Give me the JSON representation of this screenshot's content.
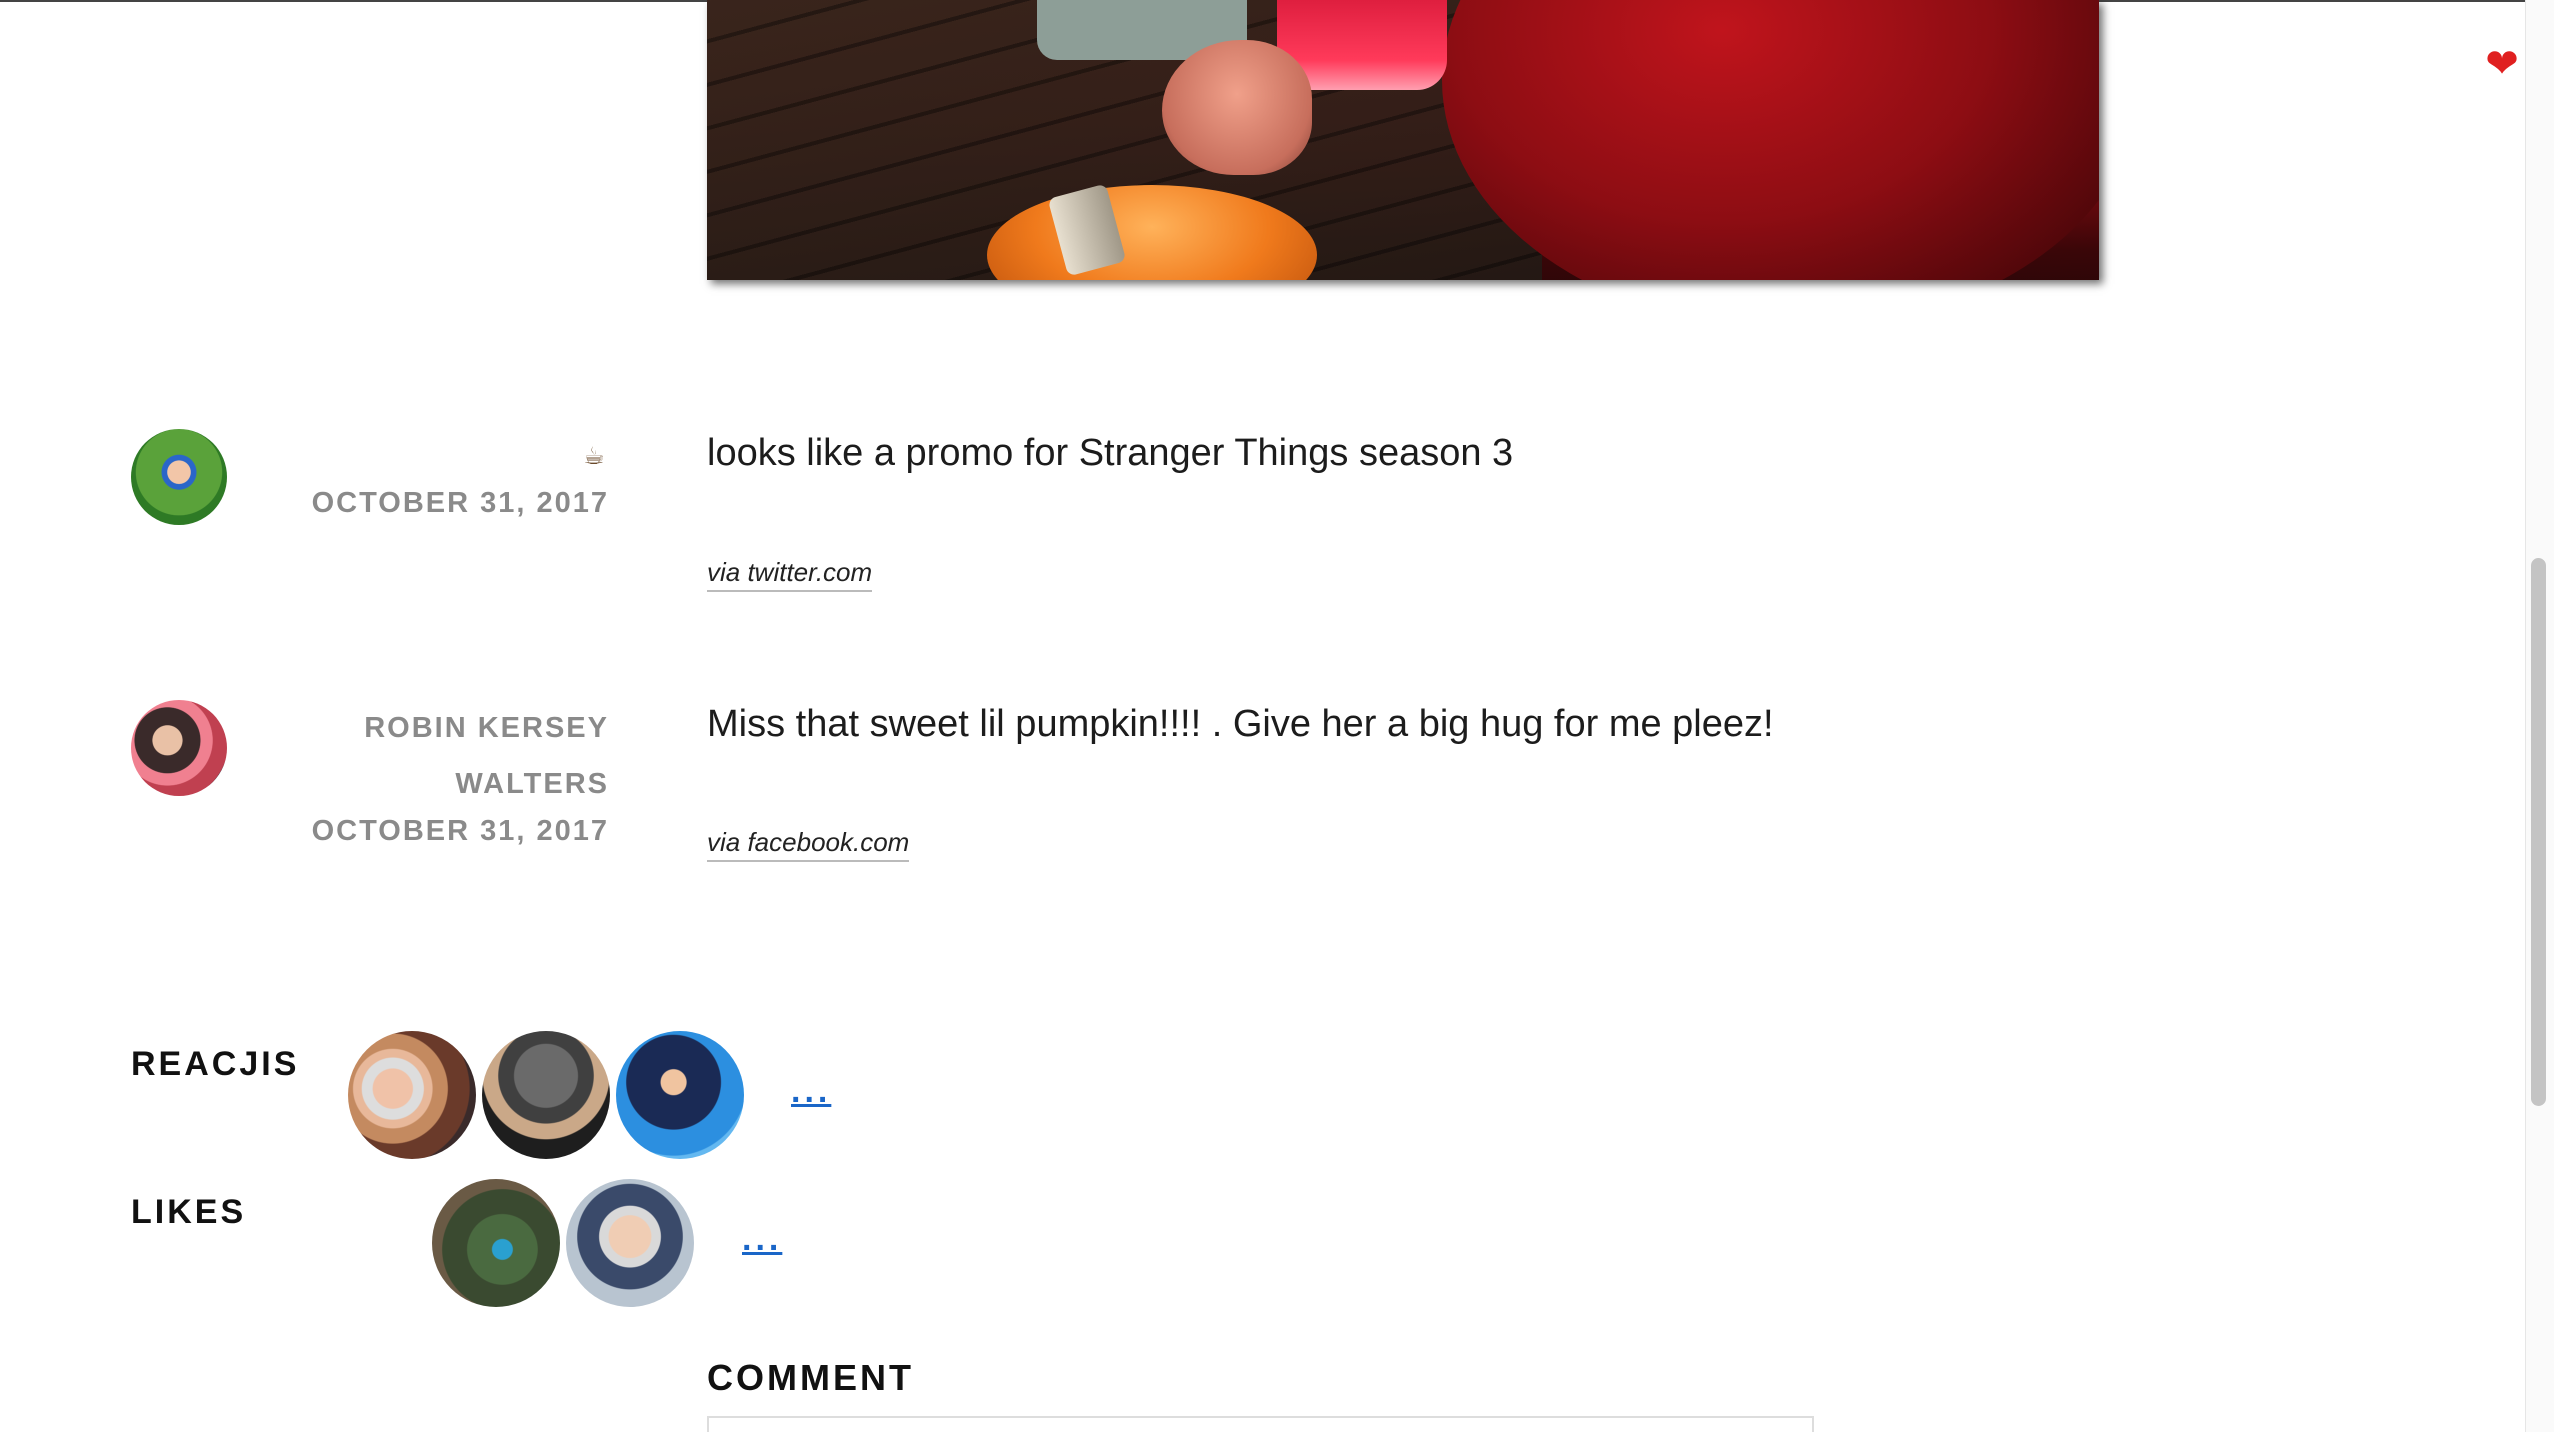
{
  "icons": {
    "heart": "heart-icon",
    "coffee": "coffee-icon"
  },
  "colors": {
    "link": "#1a66c8",
    "meta": "#8a8a8a",
    "heart": "#e02020"
  },
  "glyphs": {
    "heart": "❤",
    "coffee": "☕"
  },
  "comments": [
    {
      "author": "",
      "date": "OCTOBER 31, 2017",
      "text": "looks like a promo for Stranger Things season 3",
      "via": "via twitter.com"
    },
    {
      "author": "ROBIN KERSEY WALTERS",
      "date": "OCTOBER 31, 2017",
      "text": "Miss that sweet lil pumpkin!!!! . Give her a big hug for me pleez!",
      "via": "via facebook.com"
    }
  ],
  "reactions": {
    "reacjis_label": "REACJIS",
    "likes_label": "LIKES",
    "more_label": "..."
  },
  "comment_form": {
    "heading": "COMMENT"
  }
}
